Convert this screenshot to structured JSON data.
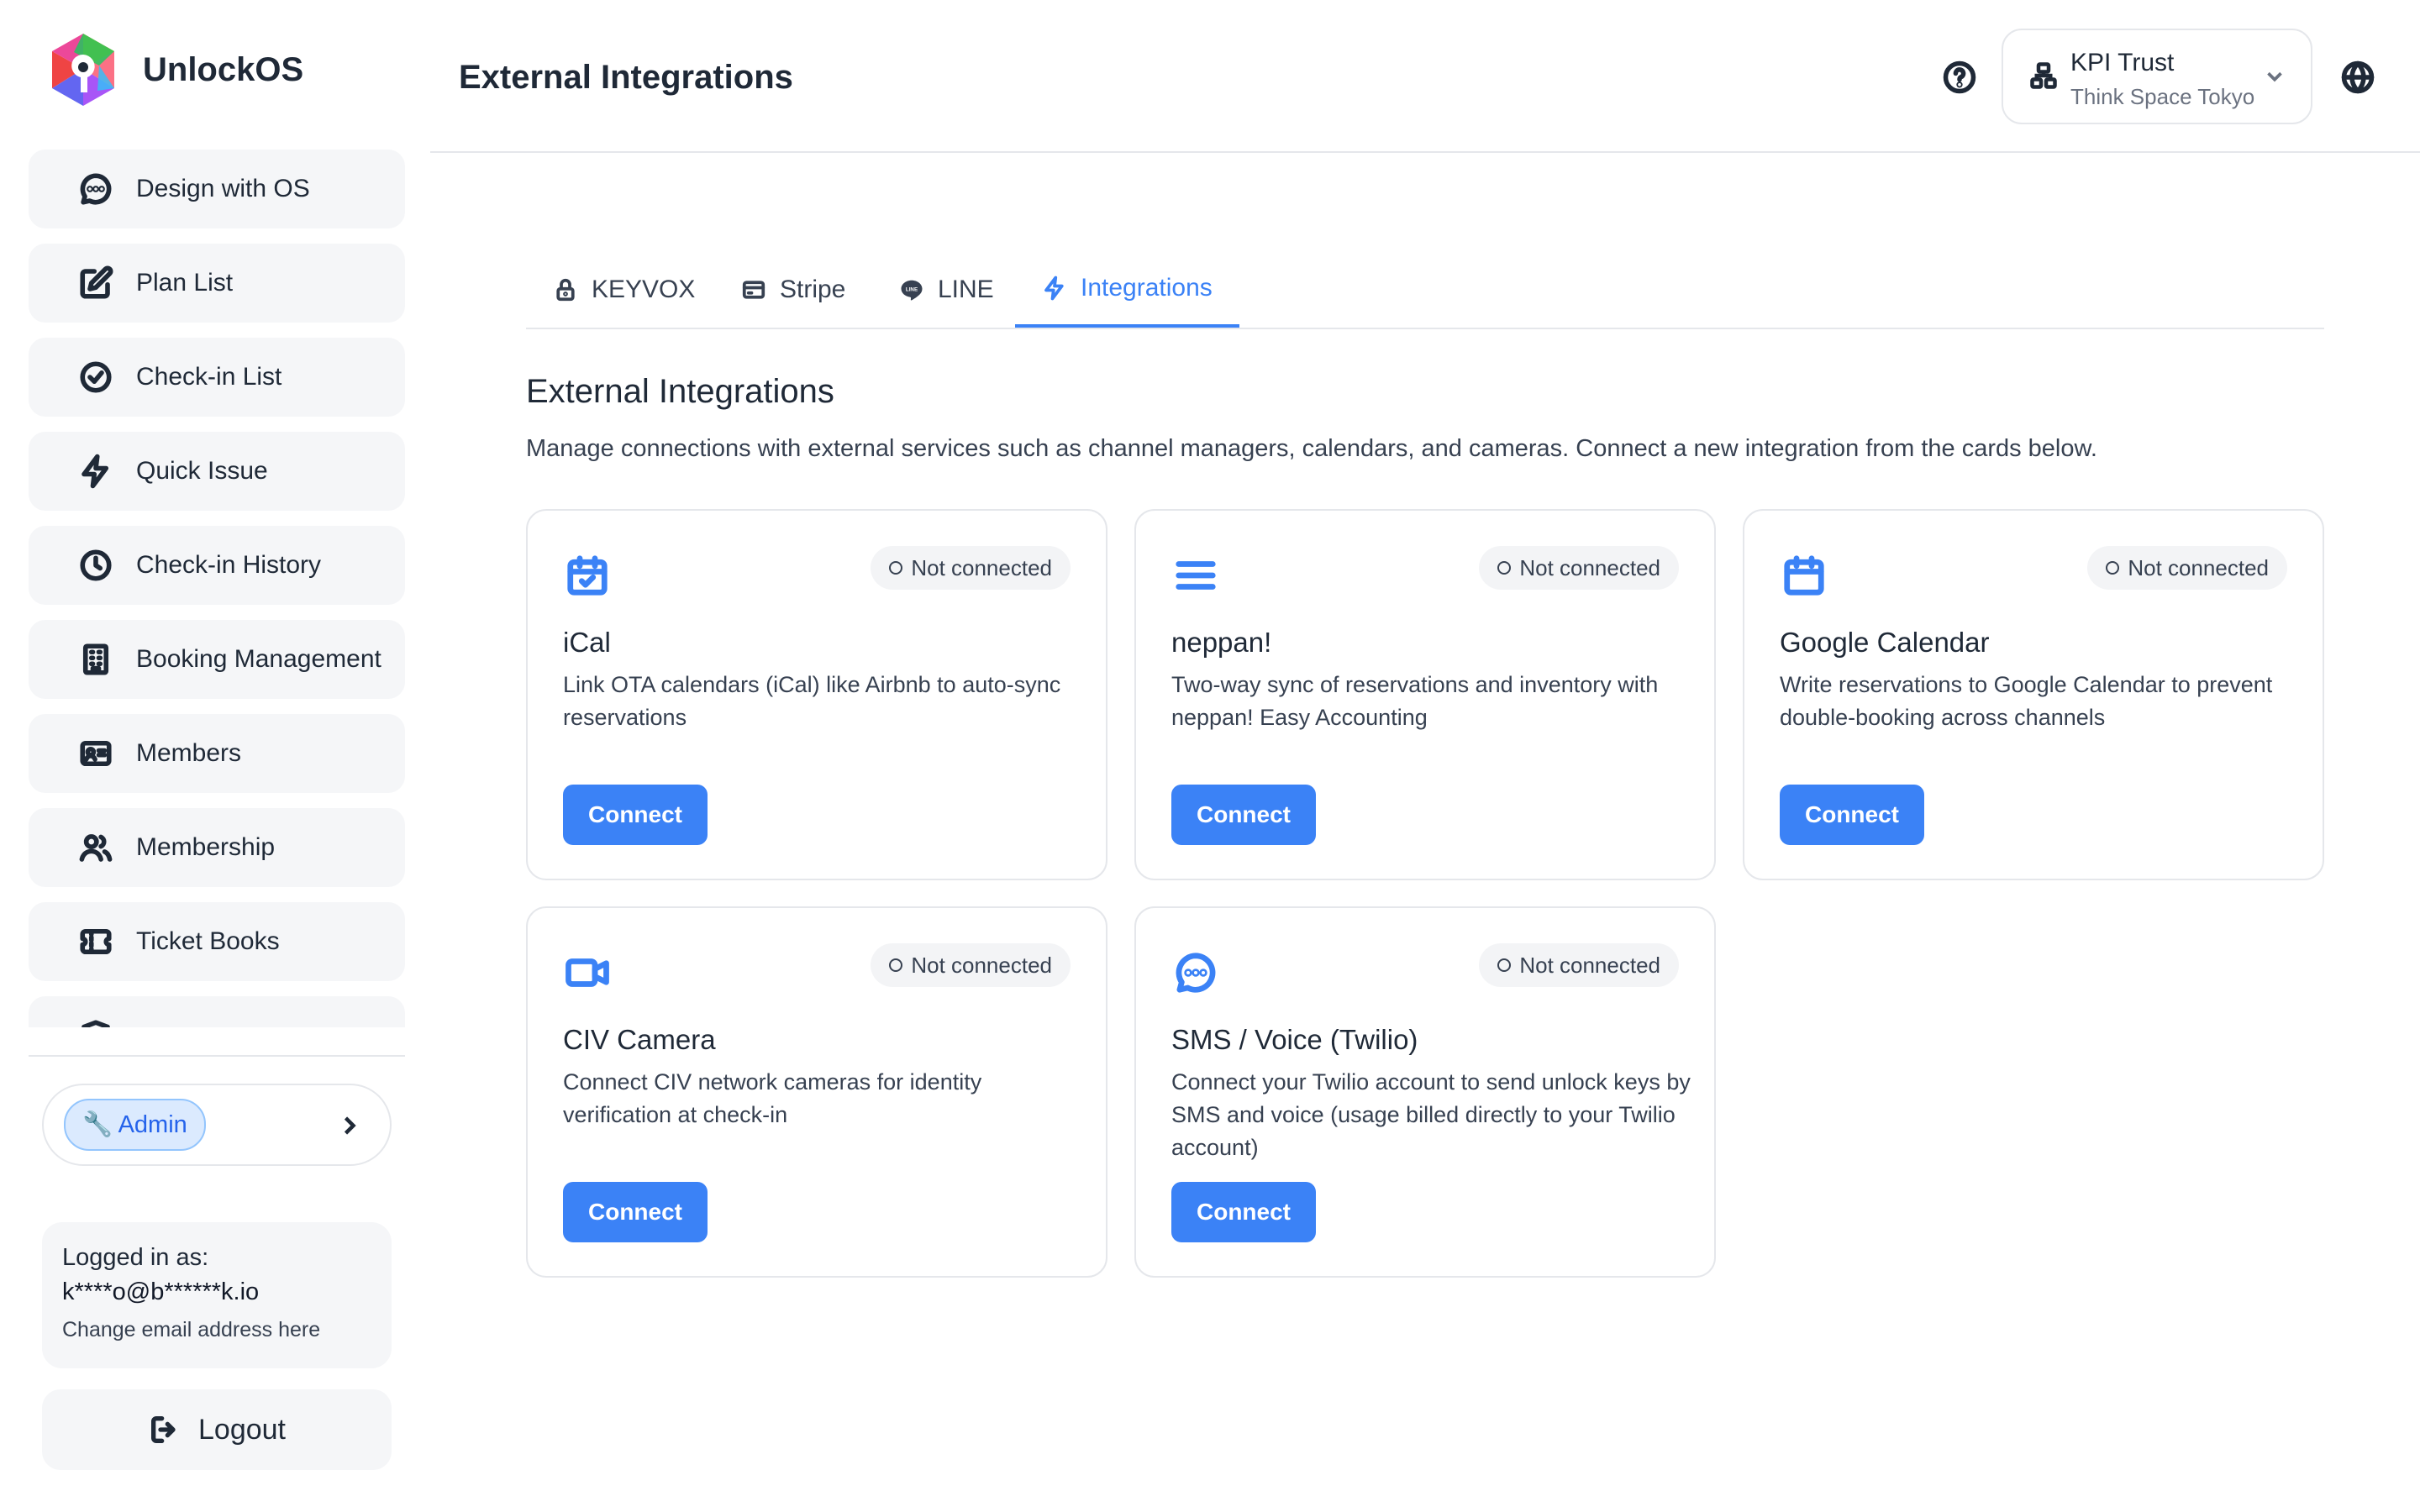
{
  "app": {
    "name": "UnlockOS"
  },
  "sidebar": {
    "items": [
      {
        "label": "Design with OS",
        "icon": "chat-bubble-icon"
      },
      {
        "label": "Plan List",
        "icon": "edit-icon"
      },
      {
        "label": "Check-in List",
        "icon": "check-circle-icon"
      },
      {
        "label": "Quick Issue",
        "icon": "lightning-icon"
      },
      {
        "label": "Check-in History",
        "icon": "clock-icon"
      },
      {
        "label": "Booking Management",
        "icon": "building-icon"
      },
      {
        "label": "Members",
        "icon": "id-card-icon"
      },
      {
        "label": "Membership",
        "icon": "users-icon"
      },
      {
        "label": "Ticket Books",
        "icon": "ticket-icon"
      }
    ],
    "admin": {
      "label": "🔧 Admin"
    },
    "user": {
      "logged_in_label": "Logged in as:",
      "email": "k****o@b******k.io",
      "change_email": "Change email address here"
    },
    "logout_label": "Logout"
  },
  "header": {
    "title": "External Integrations",
    "org": {
      "name": "KPI Trust",
      "location": "Think Space Tokyo"
    }
  },
  "tabs": [
    {
      "label": "KEYVOX",
      "icon": "lock-icon",
      "active": false
    },
    {
      "label": "Stripe",
      "icon": "credit-card-icon",
      "active": false
    },
    {
      "label": "LINE",
      "icon": "line-icon",
      "active": false
    },
    {
      "label": "Integrations",
      "icon": "lightning-icon",
      "active": true
    }
  ],
  "main": {
    "title": "External Integrations",
    "description": "Manage connections with external services such as channel managers, calendars, and cameras. Connect a new integration from the cards below."
  },
  "cards": [
    {
      "title": "iCal",
      "icon": "calendar-check-icon",
      "status": "Not connected",
      "description": "Link OTA calendars (iCal) like Airbnb to auto-sync reservations",
      "button": "Connect"
    },
    {
      "title": "neppan!",
      "icon": "menu-lines-icon",
      "status": "Not connected",
      "description": "Two-way sync of reservations and inventory with neppan! Easy Accounting",
      "button": "Connect"
    },
    {
      "title": "Google Calendar",
      "icon": "calendar-icon",
      "status": "Not connected",
      "description": "Write reservations to Google Calendar to prevent double-booking across channels",
      "button": "Connect"
    },
    {
      "title": "CIV Camera",
      "icon": "video-camera-icon",
      "status": "Not connected",
      "description": "Connect CIV network cameras for identity verification at check-in",
      "button": "Connect"
    },
    {
      "title": "SMS / Voice (Twilio)",
      "icon": "message-circle-icon",
      "status": "Not connected",
      "description": "Connect your Twilio account to send unlock keys by SMS and voice (usage billed directly to your Twilio account)",
      "button": "Connect"
    }
  ],
  "colors": {
    "accent": "#3b82f6",
    "nav_bg": "#f5f6f8",
    "border": "#e5e7eb"
  }
}
